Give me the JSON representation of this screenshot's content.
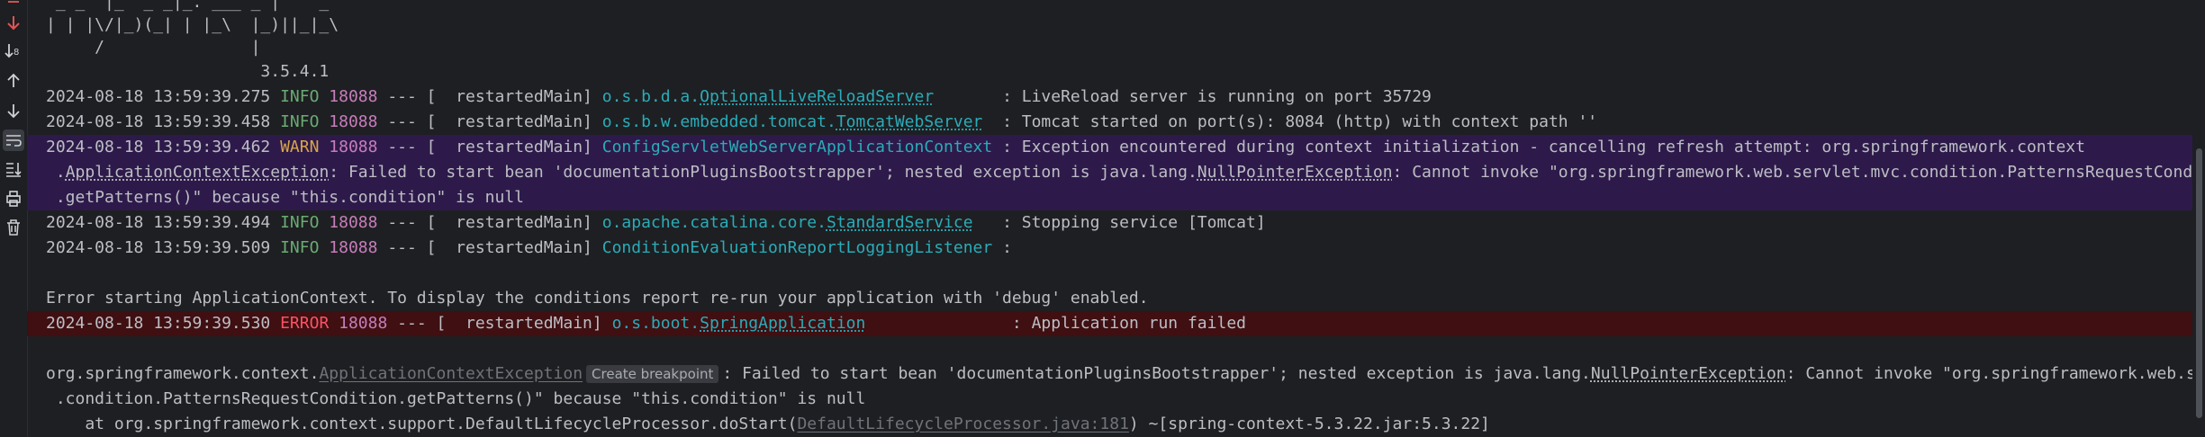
{
  "banner": {
    "line1": " _ _  |_  _ _|_. ___ _ |    _",
    "line2": "| | |\\/|_)(_| | |_\\  |_)||_|_\\",
    "line3": "     /               |",
    "version": "                      3.5.4.1"
  },
  "logs": [
    {
      "ts": "2024-08-18 13:59:39.275",
      "level": "INFO",
      "pid": "18088",
      "sep": " --- [  restartedMain] ",
      "logger_prefix": "o.s.b.d.a.",
      "logger_link": "OptionalLiveReloadServer",
      "pad": "       ",
      "msg": ": LiveReload server is running on port 35729"
    },
    {
      "ts": "2024-08-18 13:59:39.458",
      "level": "INFO",
      "pid": "18088",
      "sep": " --- [  restartedMain] ",
      "logger_prefix": "o.s.b.w.embedded.tomcat.",
      "logger_link": "TomcatWebServer",
      "pad": "  ",
      "msg": ": Tomcat started on port(s): 8084 (http) with context path ''"
    },
    {
      "ts": "2024-08-18 13:59:39.462",
      "level": "WARN",
      "pid": "18088",
      "sep": " --- [  restartedMain] ",
      "logger_prefix": "ConfigServletWebServerApplicationContext",
      "logger_link": "",
      "pad": " ",
      "msg": ": Exception encountered during context initialization - cancelling refresh attempt: org.springframework.context"
    },
    {
      "ts": "2024-08-18 13:59:39.494",
      "level": "INFO",
      "pid": "18088",
      "sep": " --- [  restartedMain] ",
      "logger_prefix": "o.apache.catalina.core.",
      "logger_link": "StandardService",
      "pad": "   ",
      "msg": ": Stopping service [Tomcat]"
    },
    {
      "ts": "2024-08-18 13:59:39.509",
      "level": "INFO",
      "pid": "18088",
      "sep": " --- [  restartedMain] ",
      "logger_prefix": "ConditionEvaluationReportLoggingListener",
      "logger_link": "",
      "pad": " ",
      "msg": ":"
    },
    {
      "ts": "2024-08-18 13:59:39.530",
      "level": "ERROR",
      "pid": "18088",
      "sep": " --- [  restartedMain] ",
      "logger_prefix": "o.s.boot.",
      "logger_link": "SpringApplication",
      "pad": "               ",
      "msg": ": Application run failed"
    }
  ],
  "warn_cont": {
    "l1_pre": " .",
    "l1_link": "ApplicationContextException",
    "l1_mid": ": Failed to start bean 'documentationPluginsBootstrapper'; nested exception is java.lang.",
    "l1_link2": "NullPointerException",
    "l1_post": ": Cannot invoke \"org.springframework.web.servlet.mvc.condition.PatternsRequestCondition",
    "l2": " .getPatterns()\" because \"this.condition\" is null"
  },
  "blank_msg": "Error starting ApplicationContext. To display the conditions report re-run your application with 'debug' enabled.",
  "trace": {
    "l1_pre": "org.springframework.context.",
    "l1_link": "ApplicationContextException",
    "tooltip": "Create breakpoint",
    "l1_mid": ": Failed to start bean 'documentationPluginsBootstrapper'; nested exception is java.lang.",
    "l1_link2": "NullPointerException",
    "l1_post": ": Cannot invoke \"org.springframework.web.servlet.mvc",
    "l2": " .condition.PatternsRequestCondition.getPatterns()\" because \"this.condition\" is null",
    "l3_pre": "    at org.springframework.context.support.DefaultLifecycleProcessor.doStart(",
    "l3_link": "DefaultLifecycleProcessor.java:181",
    "l3_post": ") ~[spring-context-5.3.22.jar:5.3.22]"
  },
  "colors": {
    "info": "#6aab73",
    "warn": "#d8a54a",
    "error": "#f75464",
    "pid": "#c77dbb",
    "logger": "#2aacb8"
  },
  "toolbar_icons": [
    "stop-icon",
    "rerun-arrow-icon",
    "sort-icon",
    "up-arrow-icon",
    "down-arrow-icon",
    "soft-wrap-icon",
    "scroll-to-end-icon",
    "print-icon",
    "trash-icon"
  ]
}
